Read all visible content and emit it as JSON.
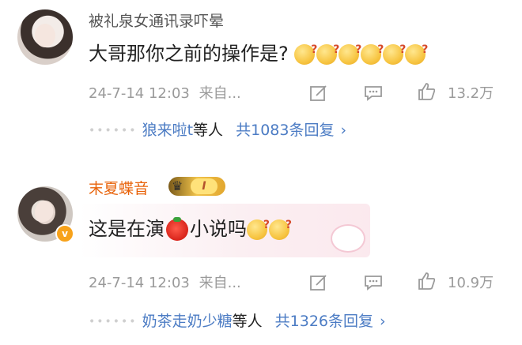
{
  "comments": [
    {
      "username": "被礼泉女通讯录吓晕",
      "text": "大哥那你之前的操作是?",
      "emoji_count": 6,
      "time": "24-7-14 12:03",
      "source": "来自...",
      "likes": "13.2万",
      "replies_names": "狼来啦t",
      "replies_suffix": "等人",
      "replies_count": "共1083条回复",
      "chevron": "›"
    },
    {
      "username": "末夏蝶音",
      "vip_level": "I",
      "text_before": "这是在演",
      "text_after": "小说吗",
      "time": "24-7-14 12:03",
      "source": "来自...",
      "likes": "10.9万",
      "replies_names": "奶茶走奶少糖",
      "replies_suffix": "等人",
      "replies_count": "共1326条回复",
      "chevron": "›"
    }
  ],
  "icons": [
    "edit-icon",
    "comment-icon",
    "like-icon",
    "verified-badge-icon",
    "vip-crown-icon",
    "tomato-emoji",
    "confused-emoji"
  ]
}
